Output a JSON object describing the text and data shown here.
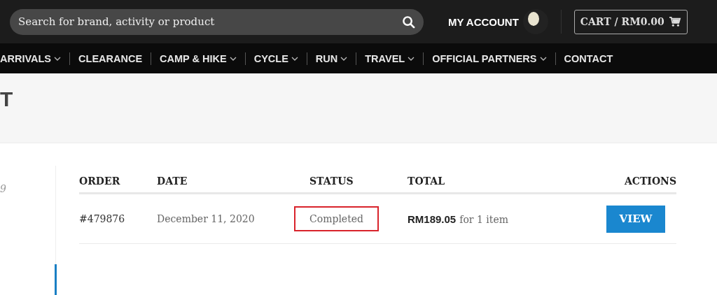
{
  "search": {
    "placeholder": "Search for brand, activity or product"
  },
  "account": {
    "label": "MY ACCOUNT"
  },
  "cart": {
    "label": "CART / RM0.00"
  },
  "nav": [
    {
      "label": "ARRIVALS",
      "dropdown": true
    },
    {
      "label": "CLEARANCE",
      "dropdown": false
    },
    {
      "label": "CAMP & HIKE",
      "dropdown": true
    },
    {
      "label": "CYCLE",
      "dropdown": true
    },
    {
      "label": "RUN",
      "dropdown": true
    },
    {
      "label": "TRAVEL",
      "dropdown": true
    },
    {
      "label": "OFFICIAL PARTNERS",
      "dropdown": true
    },
    {
      "label": "CONTACT",
      "dropdown": false
    }
  ],
  "page_title": "T",
  "sidebar": {
    "text": "9"
  },
  "table": {
    "columns": [
      "ORDER",
      "DATE",
      "STATUS",
      "TOTAL",
      "ACTIONS"
    ],
    "rows": [
      {
        "order": "#479876",
        "date": "December 11, 2020",
        "status": "Completed",
        "status_highlighted": true,
        "total": "RM189.05",
        "total_note": "for 1 item",
        "action": "VIEW"
      }
    ]
  }
}
